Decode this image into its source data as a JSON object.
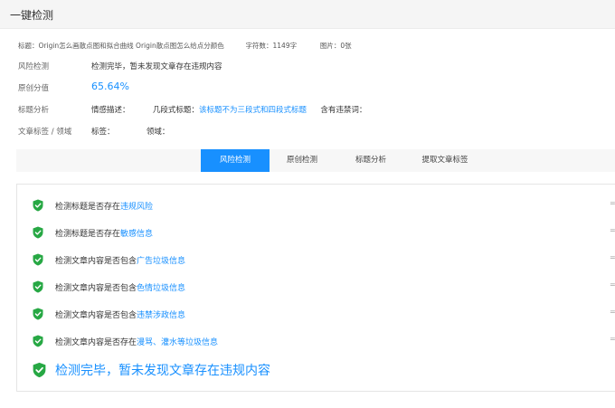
{
  "header": {
    "title": "一键检测"
  },
  "meta": {
    "title_label": "标题：",
    "title_value": "Origin怎么画散点图和拟合曲线 Origin散点图怎么给点分颜色",
    "chars_label": "字符数：",
    "chars_value": "1149字",
    "images_label": "图片：",
    "images_value": "0张"
  },
  "risk": {
    "label": "风险检测",
    "value": "检测完毕，暂未发现文章存在违规内容"
  },
  "originality": {
    "label": "原创分值",
    "value": "65.64%"
  },
  "title_analysis": {
    "label": "标题分析",
    "sentiment_label": "情感描述：",
    "segment_label": "几段式标题：",
    "segment_value": "该标题不为三段式和四段式标题",
    "banned_label": "含有违禁词："
  },
  "tags": {
    "label": "文章标签 / 领域",
    "tags_label": "标签：",
    "domain_label": "领域："
  },
  "tabs": [
    {
      "label": "风险检测",
      "active": true
    },
    {
      "label": "原创检测",
      "active": false
    },
    {
      "label": "标题分析",
      "active": false
    },
    {
      "label": "提取文章标签",
      "active": false
    }
  ],
  "checks": [
    {
      "prefix": "检测标题是否存在",
      "highlight": "违规风险"
    },
    {
      "prefix": "检测标题是否存在",
      "highlight": "敏感信息"
    },
    {
      "prefix": "检测文章内容是否包含",
      "highlight": "广告垃圾信息"
    },
    {
      "prefix": "检测文章内容是否包含",
      "highlight": "色情垃圾信息"
    },
    {
      "prefix": "检测文章内容是否包含",
      "highlight": "违禁涉政信息"
    },
    {
      "prefix": "检测文章内容是否存在",
      "highlight": "漫骂、灌水等垃圾信息"
    }
  ],
  "final": {
    "text": "检测完毕，暂未发现文章存在违规内容"
  },
  "colors": {
    "accent": "#1890ff",
    "shield": "#27a844"
  },
  "icons": {
    "check": "shield-check-icon"
  }
}
